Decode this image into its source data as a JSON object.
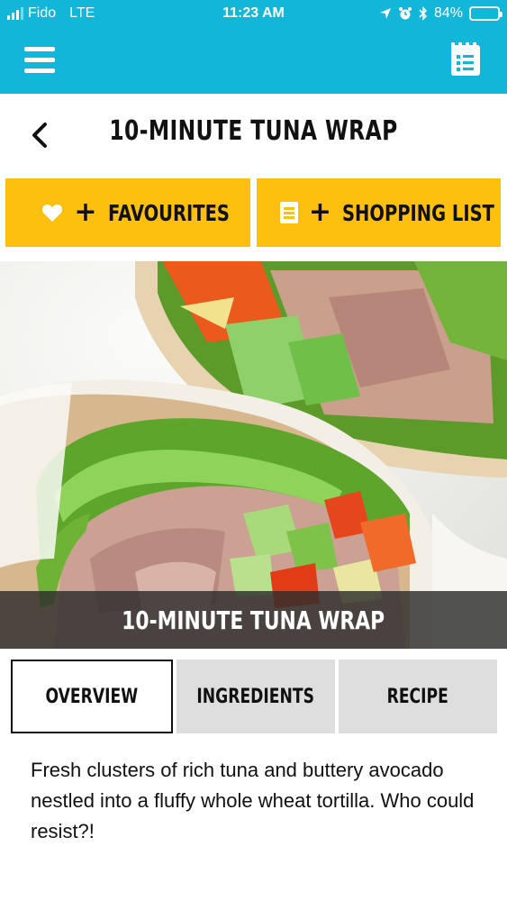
{
  "status_bar": {
    "carrier": "Fido",
    "network": "LTE",
    "time": "11:23 AM",
    "battery_percent": "84%",
    "battery_level": 0.84
  },
  "app_bar": {
    "color": "#12b6d9",
    "menu_icon": "hamburger-menu-icon",
    "list_icon": "shopping-list-icon"
  },
  "header": {
    "back_icon": "chevron-left-icon",
    "title": "10-MINUTE TUNA WRAP"
  },
  "actions": {
    "color": "#fdc00f",
    "favourites": {
      "icon": "heart-icon",
      "plus": "+",
      "label": "FAVOURITES"
    },
    "shopping_list": {
      "icon": "list-icon",
      "plus": "+",
      "label": "SHOPPING LIST"
    }
  },
  "hero": {
    "caption": "10-MINUTE TUNA WRAP"
  },
  "tabs": [
    {
      "label": "OVERVIEW",
      "active": true
    },
    {
      "label": "INGREDIENTS",
      "active": false
    },
    {
      "label": "RECIPE",
      "active": false
    }
  ],
  "overview": {
    "description": "Fresh clusters of rich tuna and buttery avocado nestled into a fluffy whole wheat tortilla. Who could resist?!"
  }
}
